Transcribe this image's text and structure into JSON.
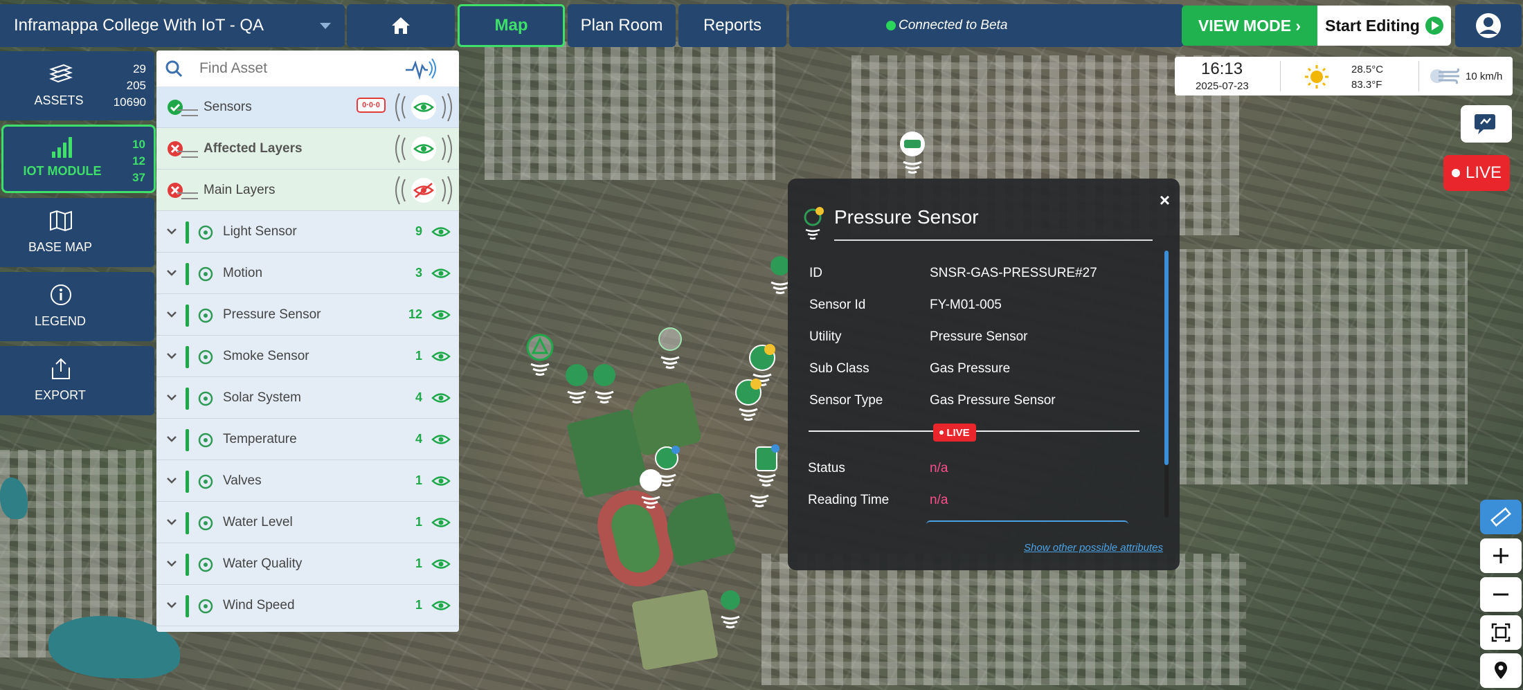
{
  "topbar": {
    "project": "Inframappa College With IoT - QA",
    "map_tab": "Map",
    "plan_room": "Plan Room",
    "reports": "Reports",
    "connection": "Connected to Beta",
    "view_mode": "VIEW MODE ›",
    "start_editing": "Start Editing"
  },
  "nav": {
    "assets": {
      "label": "ASSETS",
      "counts": [
        "29",
        "205",
        "10690"
      ]
    },
    "iot": {
      "label": "IOT MODULE",
      "counts": [
        "10",
        "12",
        "37"
      ]
    },
    "basemap": {
      "label": "BASE MAP"
    },
    "legend": {
      "label": "LEGEND"
    },
    "export": {
      "label": "EXPORT"
    }
  },
  "panel": {
    "search_placeholder": "Find Asset",
    "groups": [
      {
        "name": "Sensors",
        "status": "ok"
      },
      {
        "name": "Affected Layers",
        "status": "error"
      },
      {
        "name": "Main Layers",
        "status": "error"
      }
    ],
    "badge": "0·0·0",
    "layers": [
      {
        "name": "Light Sensor",
        "count": "9",
        "icon": "light-sensor-icon"
      },
      {
        "name": "Motion",
        "count": "3",
        "icon": "motion-icon"
      },
      {
        "name": "Pressure Sensor",
        "count": "12",
        "icon": "pressure-gauge-icon"
      },
      {
        "name": "Smoke Sensor",
        "count": "1",
        "icon": "smoke-icon"
      },
      {
        "name": "Solar System",
        "count": "4",
        "icon": "solar-panel-icon"
      },
      {
        "name": "Temperature",
        "count": "4",
        "icon": "temperature-icon"
      },
      {
        "name": "Valves",
        "count": "1",
        "icon": "valve-icon"
      },
      {
        "name": "Water Level",
        "count": "1",
        "icon": "water-level-icon"
      },
      {
        "name": "Water Quality",
        "count": "1",
        "icon": "water-quality-icon"
      },
      {
        "name": "Wind Speed",
        "count": "1",
        "icon": "wind-icon"
      }
    ]
  },
  "popup": {
    "title": "Pressure Sensor",
    "attributes": [
      {
        "label": "ID",
        "value": "SNSR-GAS-PRESSURE#27"
      },
      {
        "label": "Sensor Id",
        "value": "FY-M01-005"
      },
      {
        "label": "Utility",
        "value": "Pressure Sensor"
      },
      {
        "label": "Sub Class",
        "value": "Gas Pressure"
      },
      {
        "label": "Sensor Type",
        "value": "Gas Pressure Sensor"
      }
    ],
    "live_label": "LIVE",
    "live_attributes": [
      {
        "label": "Status",
        "value": "n/a"
      },
      {
        "label": "Reading Time",
        "value": "n/a"
      }
    ],
    "more_link": "Show other possible attributes",
    "close": "×"
  },
  "weather": {
    "time": "16:13",
    "date": "2025-07-23",
    "temp_c": "28.5°C",
    "temp_f": "83.3°F",
    "wind": "10 km/h"
  },
  "live_button": "LIVE",
  "colors": {
    "navy": "#24466f",
    "accent_green": "#3ee06a",
    "live_red": "#e8262c",
    "na_pink": "#ff4f8b",
    "link_blue": "#4aa2e4"
  }
}
